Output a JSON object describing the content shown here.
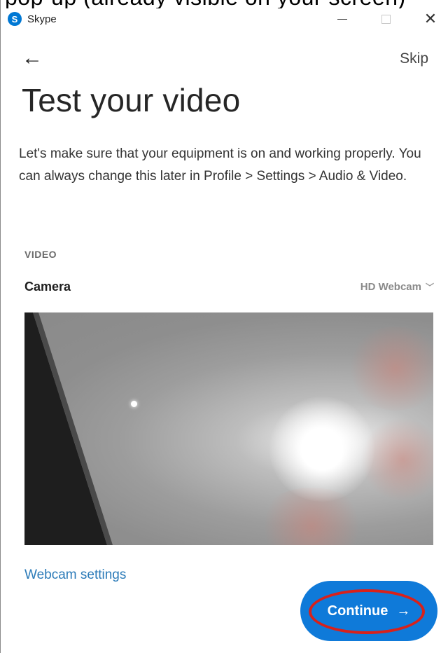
{
  "window": {
    "strip_text": "pop-up (already visible on your screen)",
    "app_icon_letter": "S",
    "app_title": "Skype",
    "minimize_symbol": "—",
    "close_symbol": "✕"
  },
  "nav": {
    "back_symbol": "←",
    "skip_label": "Skip"
  },
  "page": {
    "title": "Test your video",
    "description": "Let's make sure that your equipment is on and working properly. You can always change this later in Profile > Settings > Audio & Video."
  },
  "video": {
    "section_label": "VIDEO",
    "camera_label": "Camera",
    "camera_selected": "HD Webcam",
    "chevron": "﹀"
  },
  "actions": {
    "webcam_settings_label": "Webcam settings",
    "continue_label": "Continue",
    "continue_arrow": "→"
  },
  "colors": {
    "accent": "#0f7ad9",
    "link": "#2a7ab8",
    "highlight_outline": "#d8211b"
  },
  "icons": {
    "app": "skype-icon",
    "back": "back-arrow-icon",
    "chevron": "chevron-down-icon",
    "continue": "arrow-right-icon"
  }
}
